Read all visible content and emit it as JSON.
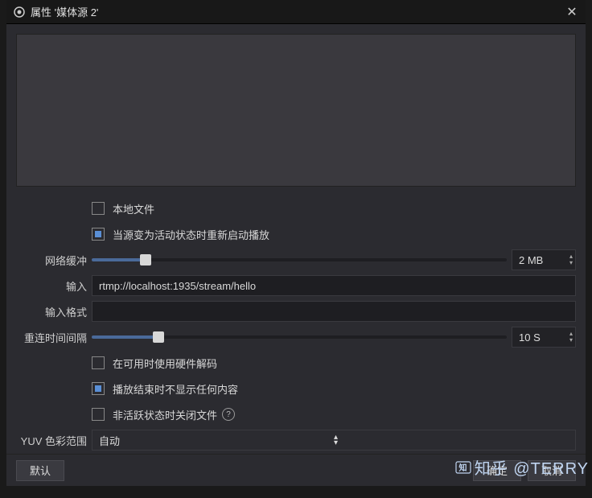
{
  "titlebar": {
    "title": "属性 '媒体源 2'"
  },
  "form": {
    "local_file": "本地文件",
    "restart_on_active": "当源变为活动状态时重新启动播放",
    "network_buffer_label": "网络缓冲",
    "network_buffer_value": "2 MB",
    "network_buffer_pct": 13,
    "input_label": "输入",
    "input_value": "rtmp://localhost:1935/stream/hello",
    "input_format_label": "输入格式",
    "input_format_value": "",
    "reconnect_label": "重连时间间隔",
    "reconnect_value": "10 S",
    "reconnect_pct": 16,
    "hw_decode": "在可用时使用硬件解码",
    "hide_on_end": "播放结束时不显示任何内容",
    "close_inactive": "非活跃状态时关闭文件",
    "yuv_label": "YUV 色彩范围",
    "yuv_value": "自动"
  },
  "footer": {
    "defaults": "默认",
    "ok": "确定",
    "cancel": "取消"
  },
  "watermark": "知乎 @TERRY"
}
